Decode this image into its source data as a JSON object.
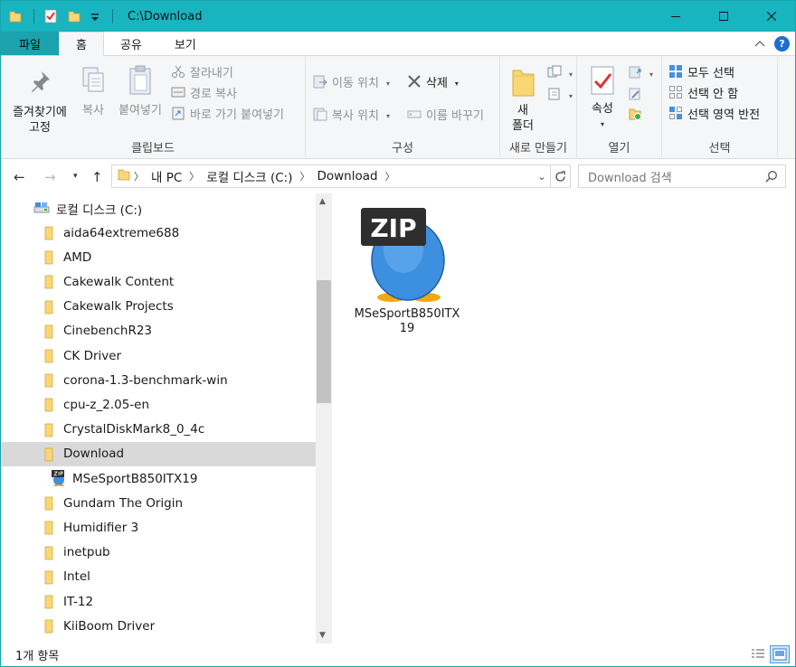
{
  "window": {
    "title": "C:\\Download",
    "accent": "#18b4bf"
  },
  "tabs": {
    "file": "파일",
    "home": "홈",
    "share": "공유",
    "view": "보기"
  },
  "ribbon": {
    "clipboard": {
      "label": "클립보드",
      "pin_line1": "즐겨찾기에",
      "pin_line2": "고정",
      "copy": "복사",
      "paste": "붙여넣기",
      "cut": "잘라내기",
      "copy_path": "경로 복사",
      "paste_shortcut": "바로 가기 붙여넣기"
    },
    "organize": {
      "label": "구성",
      "move_to": "이동 위치",
      "copy_to": "복사 위치",
      "delete": "삭제",
      "rename": "이름 바꾸기"
    },
    "new": {
      "label": "새로 만들기",
      "new_folder_line1": "새",
      "new_folder_line2": "폴더"
    },
    "open": {
      "label": "열기",
      "properties": "속성"
    },
    "select": {
      "label": "선택",
      "select_all": "모두 선택",
      "select_none": "선택 안 함",
      "invert": "선택 영역 반전"
    }
  },
  "address": {
    "crumbs": [
      "내 PC",
      "로컬 디스크 (C:)",
      "Download"
    ],
    "search_placeholder": "Download 검색"
  },
  "tree": {
    "root": "로컬 디스크 (C:)",
    "items": [
      "aida64extreme688",
      "AMD",
      "Cakewalk Content",
      "Cakewalk Projects",
      "CinebenchR23",
      "CK Driver",
      "corona-1.3-benchmark-win",
      "cpu-z_2.05-en",
      "CrystalDiskMark8_0_4c",
      "Download",
      "MSeSportB850ITX19",
      "Gundam The Origin",
      "Humidifier 3",
      "inetpub",
      "Intel",
      "IT-12",
      "KiiBoom Driver"
    ],
    "selected": "Download"
  },
  "content": {
    "file_name": "MSeSportB850ITX19",
    "file_icon_badge": "ZIP"
  },
  "status": {
    "count": "1개 항목"
  }
}
